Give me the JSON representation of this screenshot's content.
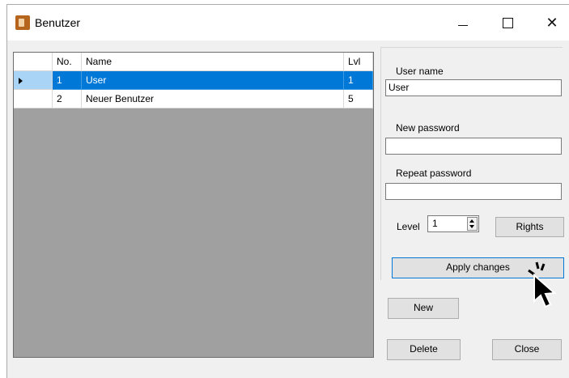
{
  "window": {
    "title": "Benutzer",
    "controls": {
      "minimize": "minimize",
      "maximize": "maximize",
      "close": "✕"
    }
  },
  "grid": {
    "columns": [
      "No.",
      "Name",
      "Lvl"
    ],
    "rows": [
      {
        "no": "1",
        "name": "User",
        "lvl": "1",
        "selected": true
      },
      {
        "no": "2",
        "name": "Neuer Benutzer",
        "lvl": "5",
        "selected": false
      }
    ]
  },
  "form": {
    "user_name_label": "User name",
    "user_name_value": "User",
    "new_password_label": "New password",
    "new_password_value": "",
    "repeat_password_label": "Repeat password",
    "repeat_password_value": "",
    "level_label": "Level",
    "level_value": "1",
    "rights_button": "Rights",
    "apply_button": "Apply changes"
  },
  "actions": {
    "new_button": "New",
    "delete_button": "Delete",
    "close_button": "Close"
  },
  "colors": {
    "selection": "#0078d7",
    "row_header_selected": "#aad4f5",
    "grid_background": "#a0a0a0"
  }
}
